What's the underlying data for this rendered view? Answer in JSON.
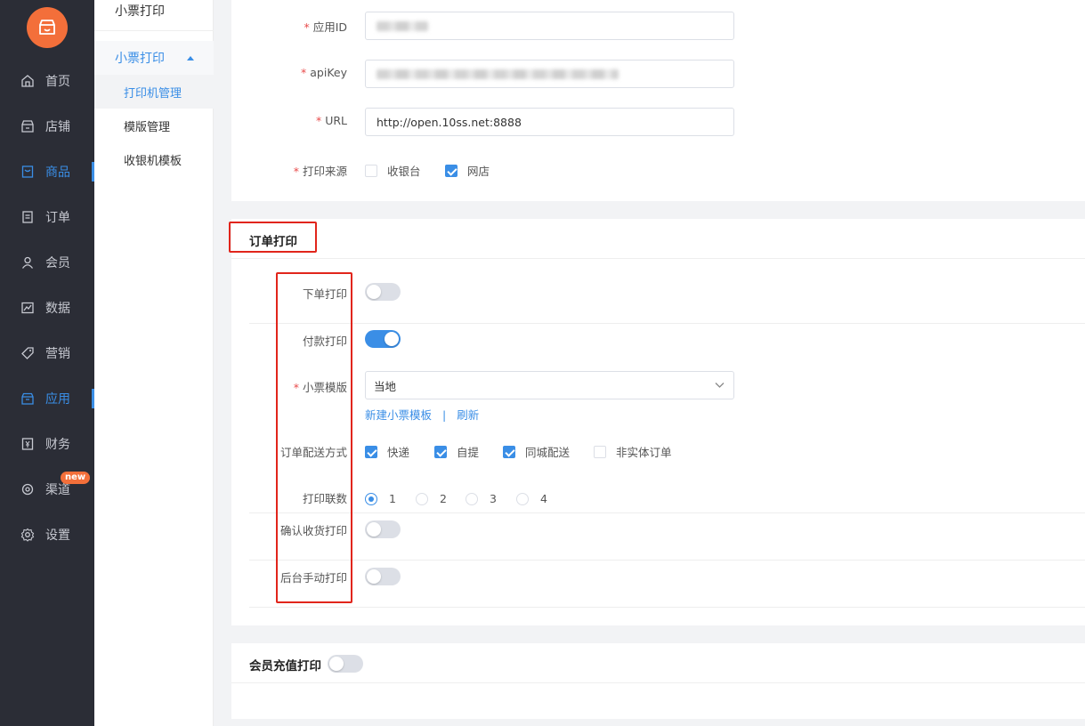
{
  "sidebar": {
    "items": [
      {
        "label": "首页",
        "icon": "home-icon"
      },
      {
        "label": "店铺",
        "icon": "store-icon"
      },
      {
        "label": "商品",
        "icon": "goods-icon"
      },
      {
        "label": "订单",
        "icon": "order-icon"
      },
      {
        "label": "会员",
        "icon": "member-icon"
      },
      {
        "label": "数据",
        "icon": "chart-icon"
      },
      {
        "label": "营销",
        "icon": "tag-icon"
      },
      {
        "label": "应用",
        "icon": "app-icon"
      },
      {
        "label": "财务",
        "icon": "finance-icon"
      },
      {
        "label": "渠道",
        "icon": "channel-icon",
        "badge": "new"
      },
      {
        "label": "设置",
        "icon": "gear-icon"
      }
    ]
  },
  "subnav": {
    "title": "小票打印",
    "group": "小票打印",
    "items": [
      "打印机管理",
      "模版管理",
      "收银机模板"
    ]
  },
  "config": {
    "app_id_label": "应用ID",
    "api_key_label": "apiKey",
    "url_label": "URL",
    "url_value": "http://open.10ss.net:8888",
    "source_label": "打印来源",
    "source_options": [
      {
        "label": "收银台",
        "checked": false
      },
      {
        "label": "网店",
        "checked": true
      }
    ]
  },
  "order_print": {
    "section_title": "订单打印",
    "place_order_label": "下单打印",
    "place_order_on": false,
    "pay_label": "付款打印",
    "pay_on": true,
    "template_label": "小票模版",
    "template_value": "当地",
    "new_template_link": "新建小票模板",
    "separator": "|",
    "refresh_link": "刷新",
    "delivery_label": "订单配送方式",
    "delivery_options": [
      {
        "label": "快递",
        "checked": true
      },
      {
        "label": "自提",
        "checked": true
      },
      {
        "label": "同城配送",
        "checked": true
      },
      {
        "label": "非实体订单",
        "checked": false
      }
    ],
    "copies_label": "打印联数",
    "copies_options": [
      "1",
      "2",
      "3",
      "4"
    ],
    "copies_selected": "1",
    "confirm_label": "确认收货打印",
    "confirm_on": false,
    "manual_label": "后台手动打印",
    "manual_on": false
  },
  "member_print": {
    "section_title": "会员充值打印",
    "on": false
  },
  "colors": {
    "accent": "#3a8ee6",
    "sidebar": "#2b2d36",
    "logo": "#f36f3a",
    "highlight": "#e1251b"
  }
}
